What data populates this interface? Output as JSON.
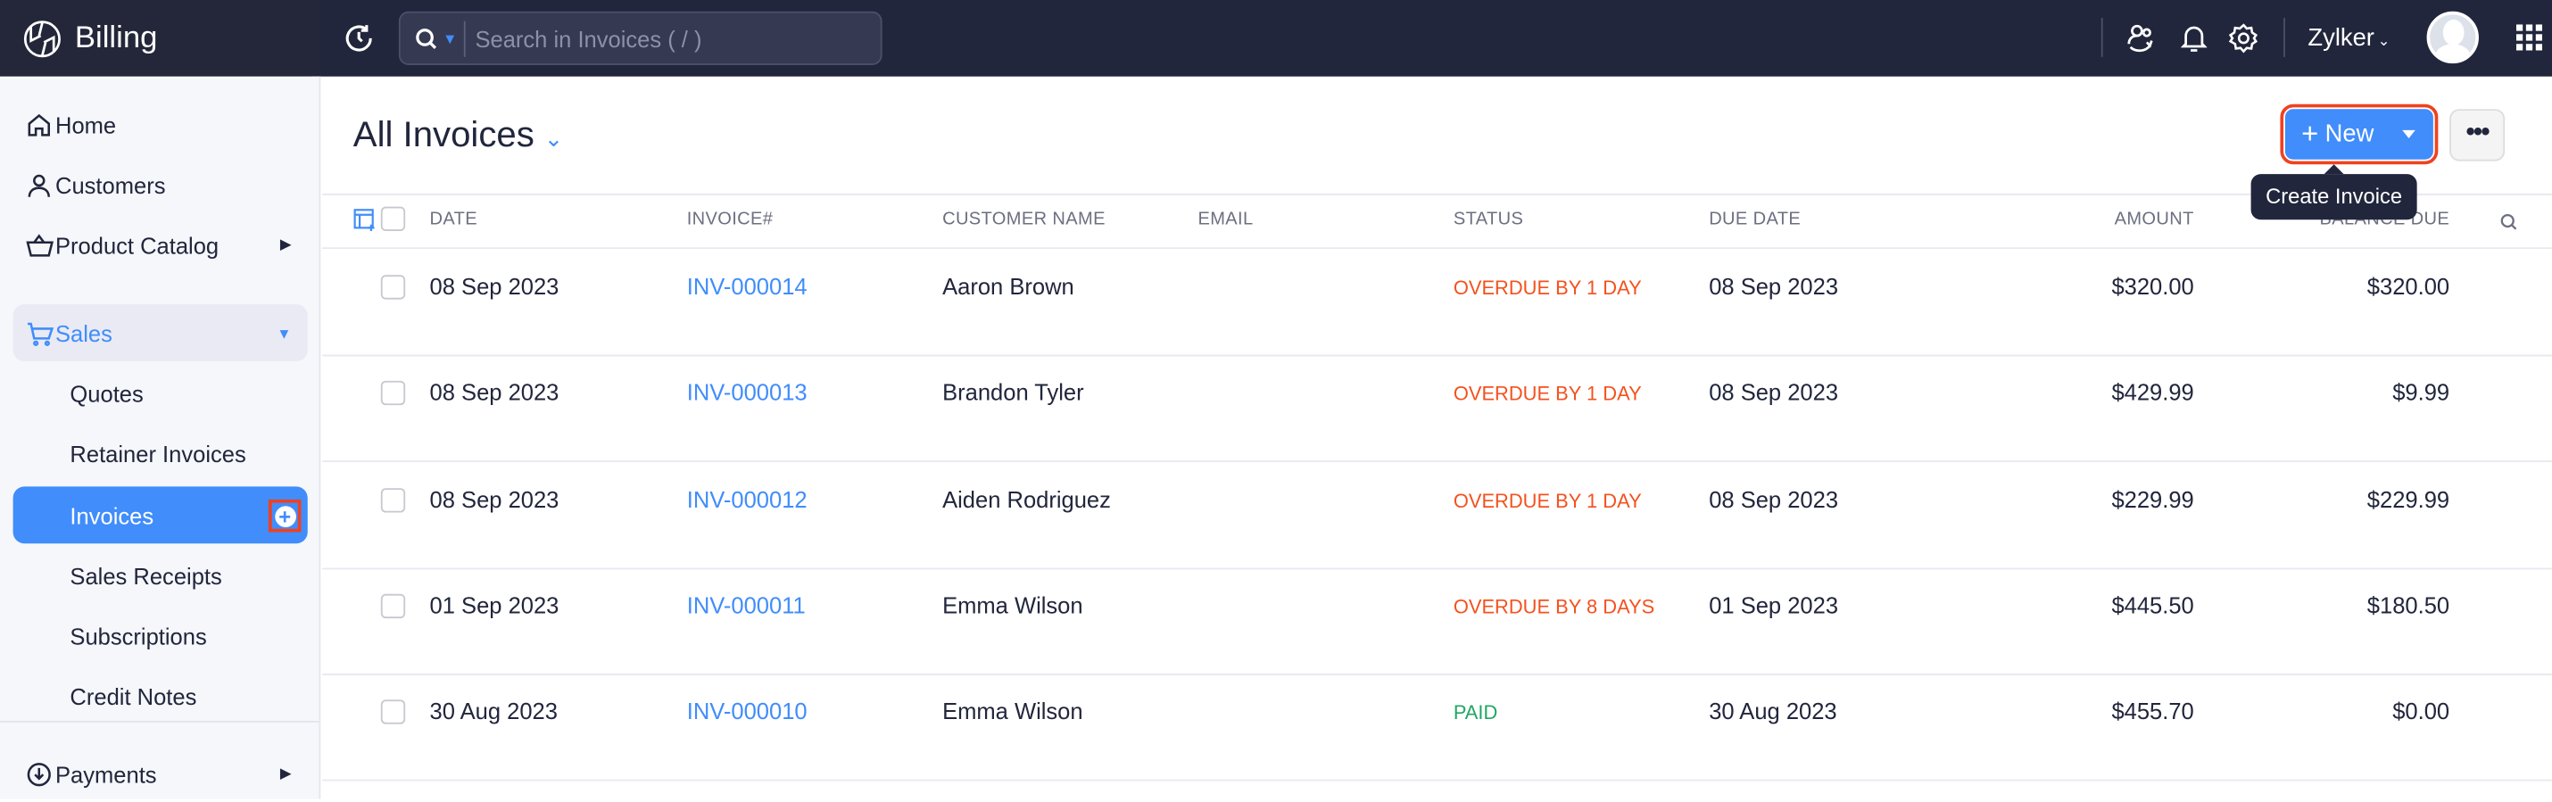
{
  "app": {
    "name": "Billing"
  },
  "topbar": {
    "search_placeholder": "Search in Invoices ( / )",
    "org": "Zylker",
    "icons": [
      "history-icon",
      "search-icon",
      "referral-icon",
      "bell-icon",
      "gear-icon",
      "avatar",
      "apps-grid-icon"
    ]
  },
  "sidebar": {
    "items": [
      {
        "label": "Home",
        "icon": "home-icon"
      },
      {
        "label": "Customers",
        "icon": "user-icon"
      },
      {
        "label": "Product Catalog",
        "icon": "basket-icon"
      },
      {
        "label": "Sales",
        "icon": "cart-icon"
      },
      {
        "label": "Quotes"
      },
      {
        "label": "Retainer Invoices"
      },
      {
        "label": "Invoices"
      },
      {
        "label": "Sales Receipts"
      },
      {
        "label": "Subscriptions"
      },
      {
        "label": "Credit Notes"
      },
      {
        "label": "Payments",
        "icon": "payments-icon"
      }
    ]
  },
  "main": {
    "title": "All Invoices",
    "new_label": "New",
    "more_label": "•••",
    "tooltip": "Create Invoice",
    "columns": [
      "DATE",
      "INVOICE#",
      "CUSTOMER NAME",
      "EMAIL",
      "STATUS",
      "DUE DATE",
      "AMOUNT",
      "BALANCE DUE"
    ],
    "rows": [
      {
        "date": "08 Sep 2023",
        "invoice": "INV-000014",
        "customer": "Aaron Brown",
        "email": "",
        "status": "OVERDUE BY 1 DAY",
        "due": "08 Sep 2023",
        "amount": "$320.00",
        "balance": "$320.00"
      },
      {
        "date": "08 Sep 2023",
        "invoice": "INV-000013",
        "customer": "Brandon Tyler",
        "email": "",
        "status": "OVERDUE BY 1 DAY",
        "due": "08 Sep 2023",
        "amount": "$429.99",
        "balance": "$9.99"
      },
      {
        "date": "08 Sep 2023",
        "invoice": "INV-000012",
        "customer": "Aiden Rodriguez",
        "email": "",
        "status": "OVERDUE BY 1 DAY",
        "due": "08 Sep 2023",
        "amount": "$229.99",
        "balance": "$229.99"
      },
      {
        "date": "01 Sep 2023",
        "invoice": "INV-000011",
        "customer": "Emma Wilson",
        "email": "",
        "status": "OVERDUE BY 8 DAYS",
        "due": "01 Sep 2023",
        "amount": "$445.50",
        "balance": "$180.50"
      },
      {
        "date": "30 Aug 2023",
        "invoice": "INV-000010",
        "customer": "Emma Wilson",
        "email": "",
        "status": "PAID",
        "due": "30 Aug 2023",
        "amount": "$455.70",
        "balance": "$0.00"
      }
    ]
  },
  "colors": {
    "accent": "#408dfb",
    "overdue": "#f4511e",
    "paid": "#22a565",
    "topbar": "#21263c",
    "highlight": "#f0411f"
  }
}
